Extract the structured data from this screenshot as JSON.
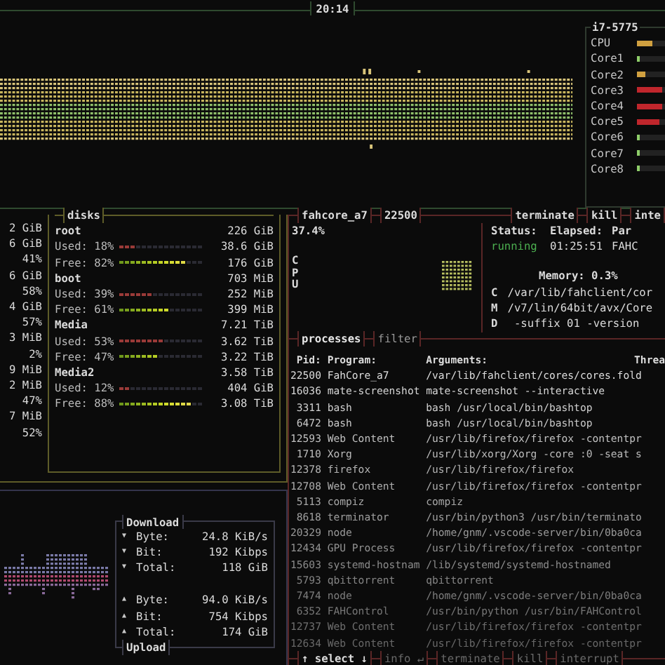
{
  "clock": "20:14",
  "cpu": {
    "model": "i7-5775",
    "meters": [
      {
        "label": "CPU",
        "level": 0.55
      },
      {
        "label": "Core1",
        "level": 0.1
      },
      {
        "label": "Core2",
        "level": 0.3
      },
      {
        "label": "Core3",
        "level": 0.9
      },
      {
        "label": "Core4",
        "level": 0.9
      },
      {
        "label": "Core5",
        "level": 0.8
      },
      {
        "label": "Core6",
        "level": 0.1
      },
      {
        "label": "Core7",
        "level": 0.12
      },
      {
        "label": "Core8",
        "level": 0.1
      }
    ]
  },
  "mem_column": [
    "2 GiB",
    "6 GiB",
    "41%",
    "6 GiB",
    "58%",
    "4 GiB",
    "57%",
    "3 MiB",
    "2%",
    "9 MiB",
    "2 MiB",
    "47%",
    "7 MiB",
    "52%"
  ],
  "disks": {
    "title": "disks",
    "items": [
      {
        "name": "root",
        "total": "226 GiB",
        "used": {
          "label": "Used: 18%",
          "level": 0.18,
          "value": "38.6 GiB"
        },
        "free": {
          "label": "Free: 82%",
          "level": 0.82,
          "value": "176 GiB"
        }
      },
      {
        "name": "boot",
        "total": "703 MiB",
        "used": {
          "label": "Used: 39%",
          "level": 0.39,
          "value": "252 MiB"
        },
        "free": {
          "label": "Free: 61%",
          "level": 0.61,
          "value": "399 MiB"
        }
      },
      {
        "name": "Media",
        "total": "7.21 TiB",
        "used": {
          "label": "Used: 53%",
          "level": 0.53,
          "value": "3.62 TiB"
        },
        "free": {
          "label": "Free: 47%",
          "level": 0.47,
          "value": "3.22 TiB"
        }
      },
      {
        "name": "Media2",
        "total": "3.58 TiB",
        "used": {
          "label": "Used: 12%",
          "level": 0.12,
          "value": "404 GiB"
        },
        "free": {
          "label": "Free: 88%",
          "level": 0.88,
          "value": "3.08 TiB"
        }
      }
    ]
  },
  "net": {
    "download": {
      "title": "Download",
      "rows": [
        {
          "arrow": "▼",
          "label": "Byte:",
          "value": "24.8 KiB/s"
        },
        {
          "arrow": "▼",
          "label": "Bit:",
          "value": "192 Kibps"
        },
        {
          "arrow": "▼",
          "label": "Total:",
          "value": "118 GiB"
        }
      ]
    },
    "upload": {
      "title": "Upload",
      "rows": [
        {
          "arrow": "▲",
          "label": "Byte:",
          "value": "94.0 KiB/s"
        },
        {
          "arrow": "▲",
          "label": "Bit:",
          "value": "754 Kibps"
        },
        {
          "arrow": "▲",
          "label": "Total:",
          "value": "174 GiB"
        }
      ]
    }
  },
  "process_detail": {
    "name": "fahcore_a7",
    "pid": "22500",
    "buttons": [
      "terminate",
      "kill",
      "inte"
    ],
    "cpu_percent": "37.4%",
    "cpu_label": "CPU",
    "status_headers": [
      "Status:",
      "Elapsed:",
      "Par"
    ],
    "status_values": [
      "running",
      "01:25:51",
      "FAHC"
    ],
    "memory": "Memory: 0.3%",
    "cmd_label": "CMD",
    "cmd_lines": [
      "/var/lib/fahclient/cor",
      "/v7/lin/64bit/avx/Core",
      " -suffix 01 -version"
    ]
  },
  "process_tabs": [
    {
      "label": "processes",
      "selected": true
    },
    {
      "label": "filter",
      "selected": false
    }
  ],
  "columns": [
    "Pid:",
    "Program:",
    "Arguments:",
    "Threa"
  ],
  "rows": [
    [
      "22500",
      "FahCore_a7",
      "/var/lib/fahclient/cores/cores.fold"
    ],
    [
      "16036",
      "mate-screenshot",
      "mate-screenshot --interactive"
    ],
    [
      "3311",
      "bash",
      "bash /usr/local/bin/bashtop"
    ],
    [
      "6472",
      "bash",
      "bash /usr/local/bin/bashtop"
    ],
    [
      "12593",
      "Web Content",
      "/usr/lib/firefox/firefox -contentpr"
    ],
    [
      "1710",
      "Xorg",
      "/usr/lib/xorg/Xorg -core :0 -seat s"
    ],
    [
      "12378",
      "firefox",
      "/usr/lib/firefox/firefox"
    ],
    [
      "12708",
      "Web Content",
      "/usr/lib/firefox/firefox -contentpr"
    ],
    [
      "5113",
      "compiz",
      "compiz"
    ],
    [
      "8618",
      "terminator",
      "/usr/bin/python3 /usr/bin/terminato"
    ],
    [
      "20329",
      "node",
      "/home/gnm/.vscode-server/bin/0ba0ca"
    ],
    [
      "12434",
      "GPU Process",
      "/usr/lib/firefox/firefox -contentpr"
    ],
    [
      "15603",
      "systemd-hostnam",
      "/lib/systemd/systemd-hostnamed"
    ],
    [
      "5793",
      "qbittorrent",
      "qbittorrent"
    ],
    [
      "7474",
      "node",
      "/home/gnm/.vscode-server/bin/0ba0ca"
    ],
    [
      "6352",
      "FAHControl",
      "/usr/bin/python /usr/bin/FAHControl"
    ],
    [
      "12737",
      "Web Content",
      "/usr/lib/firefox/firefox -contentpr"
    ],
    [
      "12634",
      "Web Content",
      "/usr/lib/firefox/firefox -contentpr"
    ]
  ],
  "footer": [
    {
      "label": "↑ select ↓",
      "disabled": false
    },
    {
      "label": "info ↵",
      "disabled": true
    },
    {
      "label": "terminate",
      "disabled": true
    },
    {
      "label": "kill",
      "disabled": true
    },
    {
      "label": "interrupt",
      "disabled": true
    }
  ]
}
